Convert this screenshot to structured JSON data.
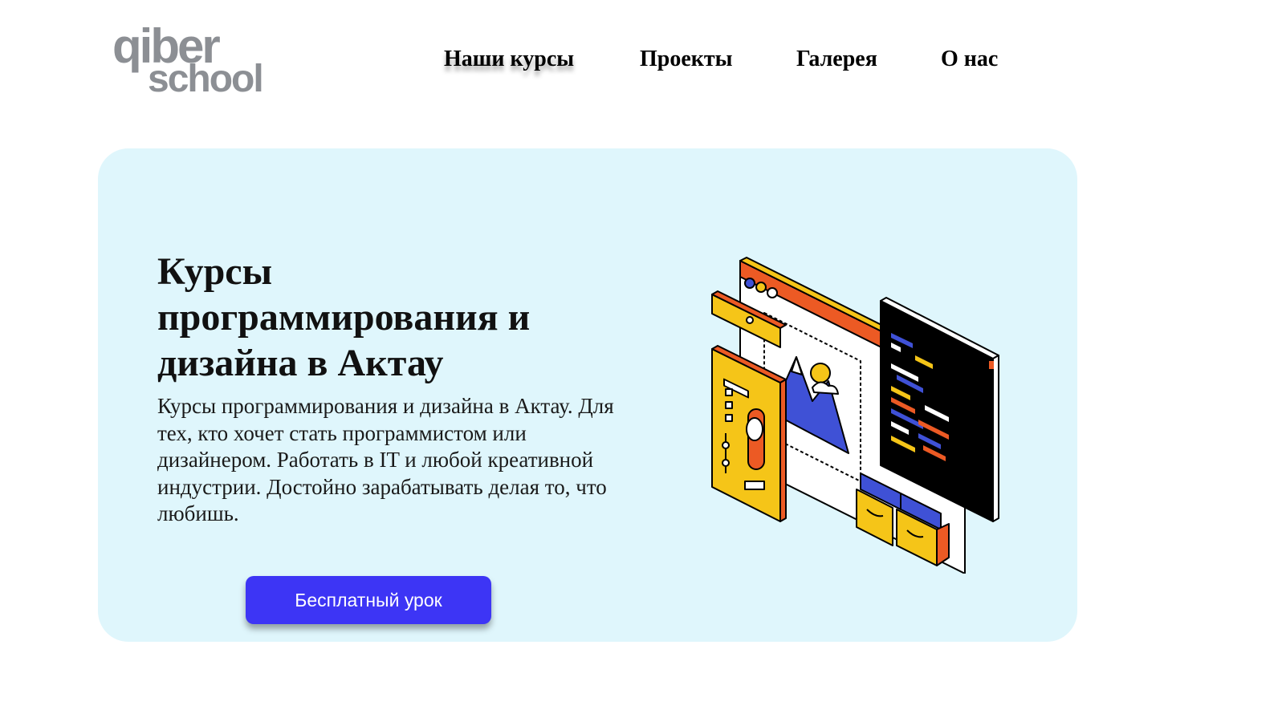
{
  "logo": {
    "line1": "qiber",
    "line2": "school"
  },
  "nav": {
    "items": [
      "Наши курсы",
      "Проекты",
      "Галерея",
      "О нас"
    ]
  },
  "hero": {
    "title": "Курсы программирования и дизайна в Актау",
    "description": "Курсы программирования и дизайна в Актау. Для тех, кто хочет стать программистом или дизайнером. Работать в IT и любой креативной индустрии. Достойно зарабатывать делая то, что любишь.",
    "cta_label": "Бесплатный урок"
  },
  "colors": {
    "hero_background": "#dff6fc",
    "cta_background": "#3d35f5",
    "logo": "#8c8f94",
    "illustration_yellow": "#f5c518",
    "illustration_orange": "#ec5a24",
    "illustration_blue": "#3f51d6"
  }
}
